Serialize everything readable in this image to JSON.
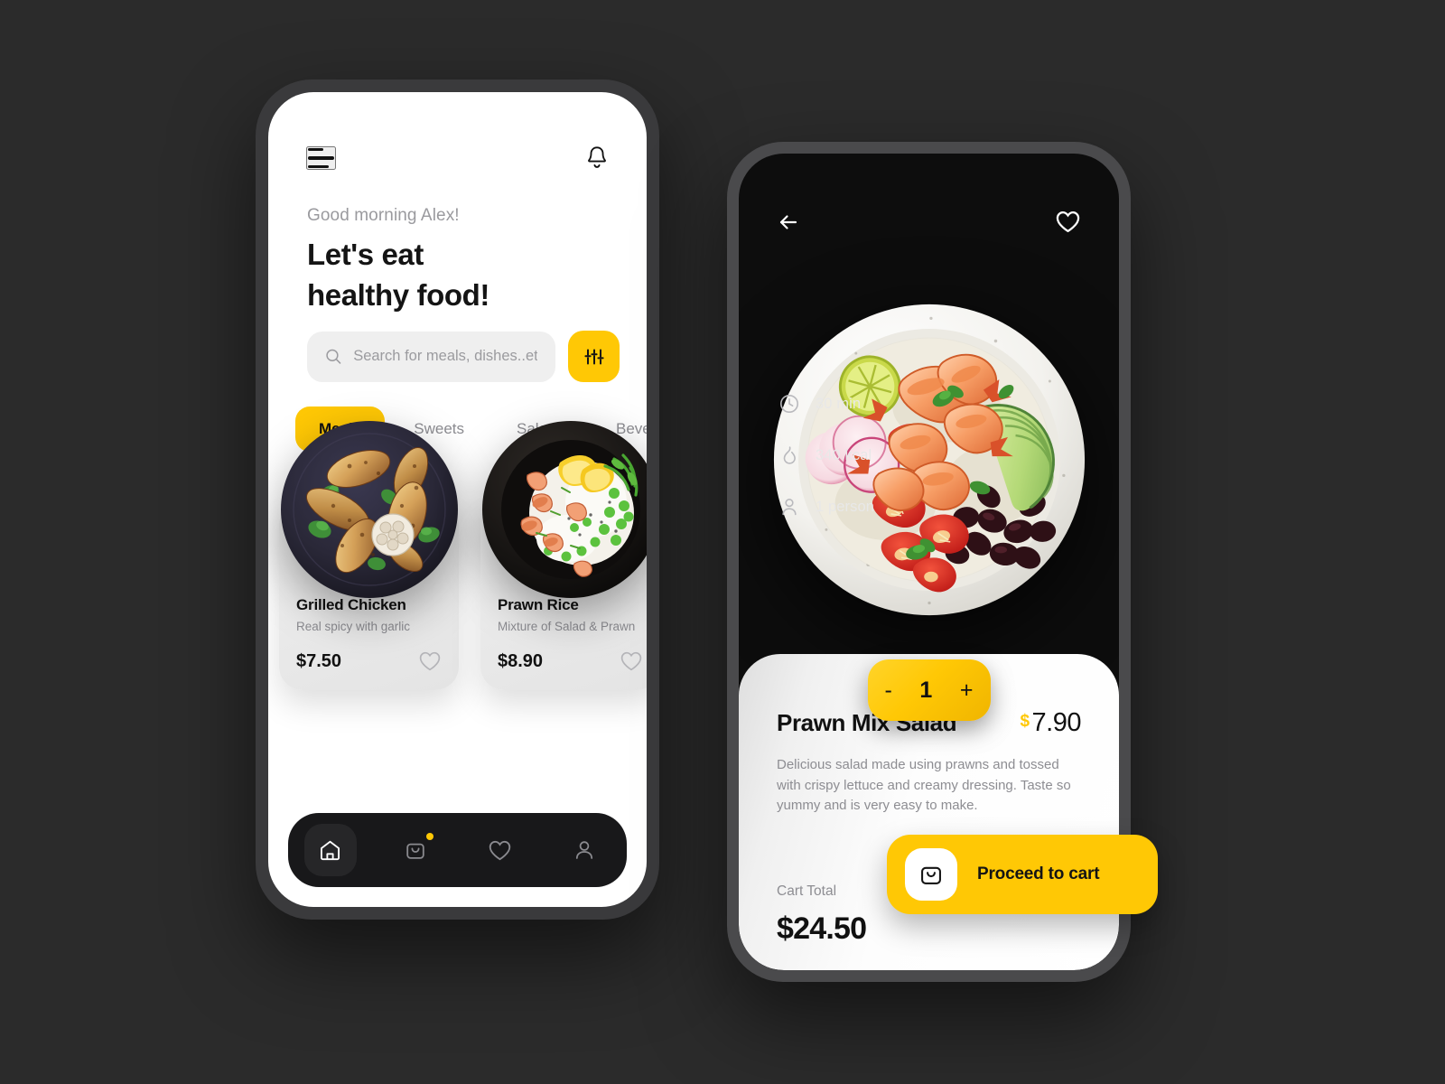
{
  "theme": {
    "accent": "#FFC805",
    "page_background": "#2b2b2b",
    "dark_screen": "#0d0d0d",
    "light_screen": "#ffffff"
  },
  "home_screen": {
    "menu_icon": "hamburger-menu-icon",
    "notification_icon": "bell-icon",
    "greeting": "Good morning Alex!",
    "headline_line1": "Let's eat",
    "headline_line2": "healthy food!",
    "search": {
      "placeholder": "Search for meals, dishes..etc",
      "value": "",
      "icon": "search-icon"
    },
    "filter_button_icon": "sliders-filter-icon",
    "tabs": [
      {
        "label": "Meals",
        "active": true
      },
      {
        "label": "Sweets",
        "active": false
      },
      {
        "label": "Salads",
        "active": false
      },
      {
        "label": "Bevera",
        "active": false
      }
    ],
    "cards": [
      {
        "title": "Grilled Chicken",
        "subtitle": "Real spicy with garlic",
        "price": "$7.50",
        "favorite_icon": "heart-outline-icon",
        "dish": "grilled-chicken-drumsticks-on-dark-plate"
      },
      {
        "title": "Prawn Rice",
        "subtitle": "Mixture of Salad & Prawn",
        "price": "$8.90",
        "favorite_icon": "heart-outline-icon",
        "dish": "prawn-rice-bowl-with-peas-and-lemon"
      }
    ],
    "bottom_nav": [
      {
        "name": "home",
        "icon": "home-icon",
        "active": true,
        "badge": false
      },
      {
        "name": "orders",
        "icon": "shopping-bag-icon",
        "active": false,
        "badge": true
      },
      {
        "name": "favorites",
        "icon": "heart-outline-icon",
        "active": false,
        "badge": false
      },
      {
        "name": "profile",
        "icon": "person-icon",
        "active": false,
        "badge": false
      }
    ]
  },
  "detail_screen": {
    "back_icon": "arrow-left-icon",
    "favorite_icon": "heart-outline-icon",
    "hero_dish": "prawn-mix-salad-bowl-with-avocado-tomato-black-beans",
    "meta": [
      {
        "icon": "clock-icon",
        "label": "30 min"
      },
      {
        "icon": "flame-icon",
        "label": "340 kcal"
      },
      {
        "icon": "person-icon",
        "label": "1 person"
      }
    ],
    "stepper": {
      "decrement_label": "-",
      "quantity": "1",
      "increment_label": "+"
    },
    "title": "Prawn Mix Salad",
    "price_currency": "$",
    "price_amount": "7.90",
    "description": "Delicious salad made using prawns and tossed with crispy lettuce and creamy dressing. Taste so yummy and is very easy to make.",
    "cart_total_label": "Cart Total",
    "cart_total_value": "$24.50",
    "proceed_button": {
      "label": "Proceed to cart",
      "icon": "shopping-bag-icon"
    }
  }
}
